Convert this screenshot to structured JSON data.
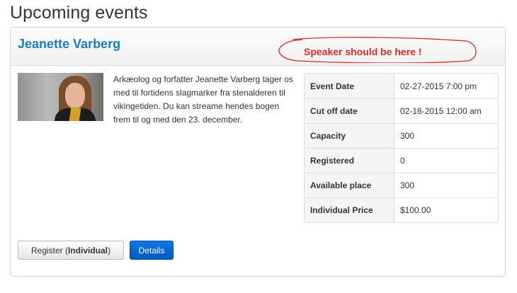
{
  "page": {
    "title": "Upcoming events"
  },
  "event": {
    "name": "Jeanette Varberg",
    "description": "Arkæolog og forfatter Jeanette Varberg tager os med til fortidens slagmarker fra stenalderen til vikingetiden. Du kan streame hendes bogen frem til og med den 23. december.",
    "annotation": "Speaker should be here !",
    "details": [
      {
        "label": "Event Date",
        "value": "02-27-2015 7:00 pm"
      },
      {
        "label": "Cut off date",
        "value": "02-18-2015 12:00 am"
      },
      {
        "label": "Capacity",
        "value": "300"
      },
      {
        "label": "Registered",
        "value": "0"
      },
      {
        "label": "Available place",
        "value": "300"
      },
      {
        "label": "Individual Price",
        "value": "$100.00"
      }
    ]
  },
  "actions": {
    "register_label": "Register (",
    "register_type": "Individual",
    "register_suffix": ")",
    "details_label": "Details"
  },
  "colors": {
    "title_blue": "#1a7fc1",
    "annotation_red": "#d22b2b",
    "primary_button": "#0a6fd6"
  }
}
